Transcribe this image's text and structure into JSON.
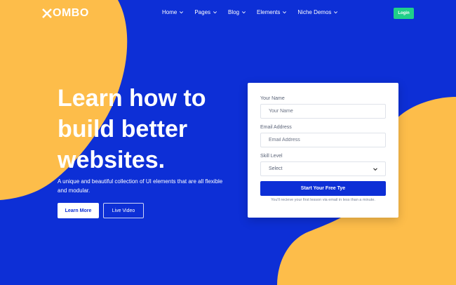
{
  "brand": {
    "logo_text": "OMBO",
    "logo_mark": "x-logo-mark"
  },
  "nav": {
    "items": [
      {
        "label": "Home",
        "icon": "chevron-down-icon"
      },
      {
        "label": "Pages",
        "icon": "chevron-down-icon"
      },
      {
        "label": "Blog",
        "icon": "chevron-down-icon"
      },
      {
        "label": "Elements",
        "icon": "chevron-down-icon"
      },
      {
        "label": "Niche Demos",
        "icon": "chevron-down-icon"
      }
    ],
    "login_label": "Login"
  },
  "hero": {
    "title": "Learn how to build better websites.",
    "subtitle": "A unique and beautiful collection of UI elements that are all flexible and modular.",
    "primary_button": "Learn More",
    "secondary_button": "Live Video"
  },
  "form": {
    "name_label": "Your Name",
    "name_placeholder": "Your Name",
    "email_label": "Email Address",
    "email_placeholder": "Email Address",
    "skill_label": "Skill Level",
    "skill_selected": "Select",
    "submit_label": "Start Your Free Tye",
    "note": "You'll recieve your first lesson via email in less than a minute."
  },
  "colors": {
    "background_blue": "#0d2fd6",
    "accent_yellow": "#fdbd4a",
    "login_green": "#1fcf8a",
    "card_white": "#ffffff"
  }
}
